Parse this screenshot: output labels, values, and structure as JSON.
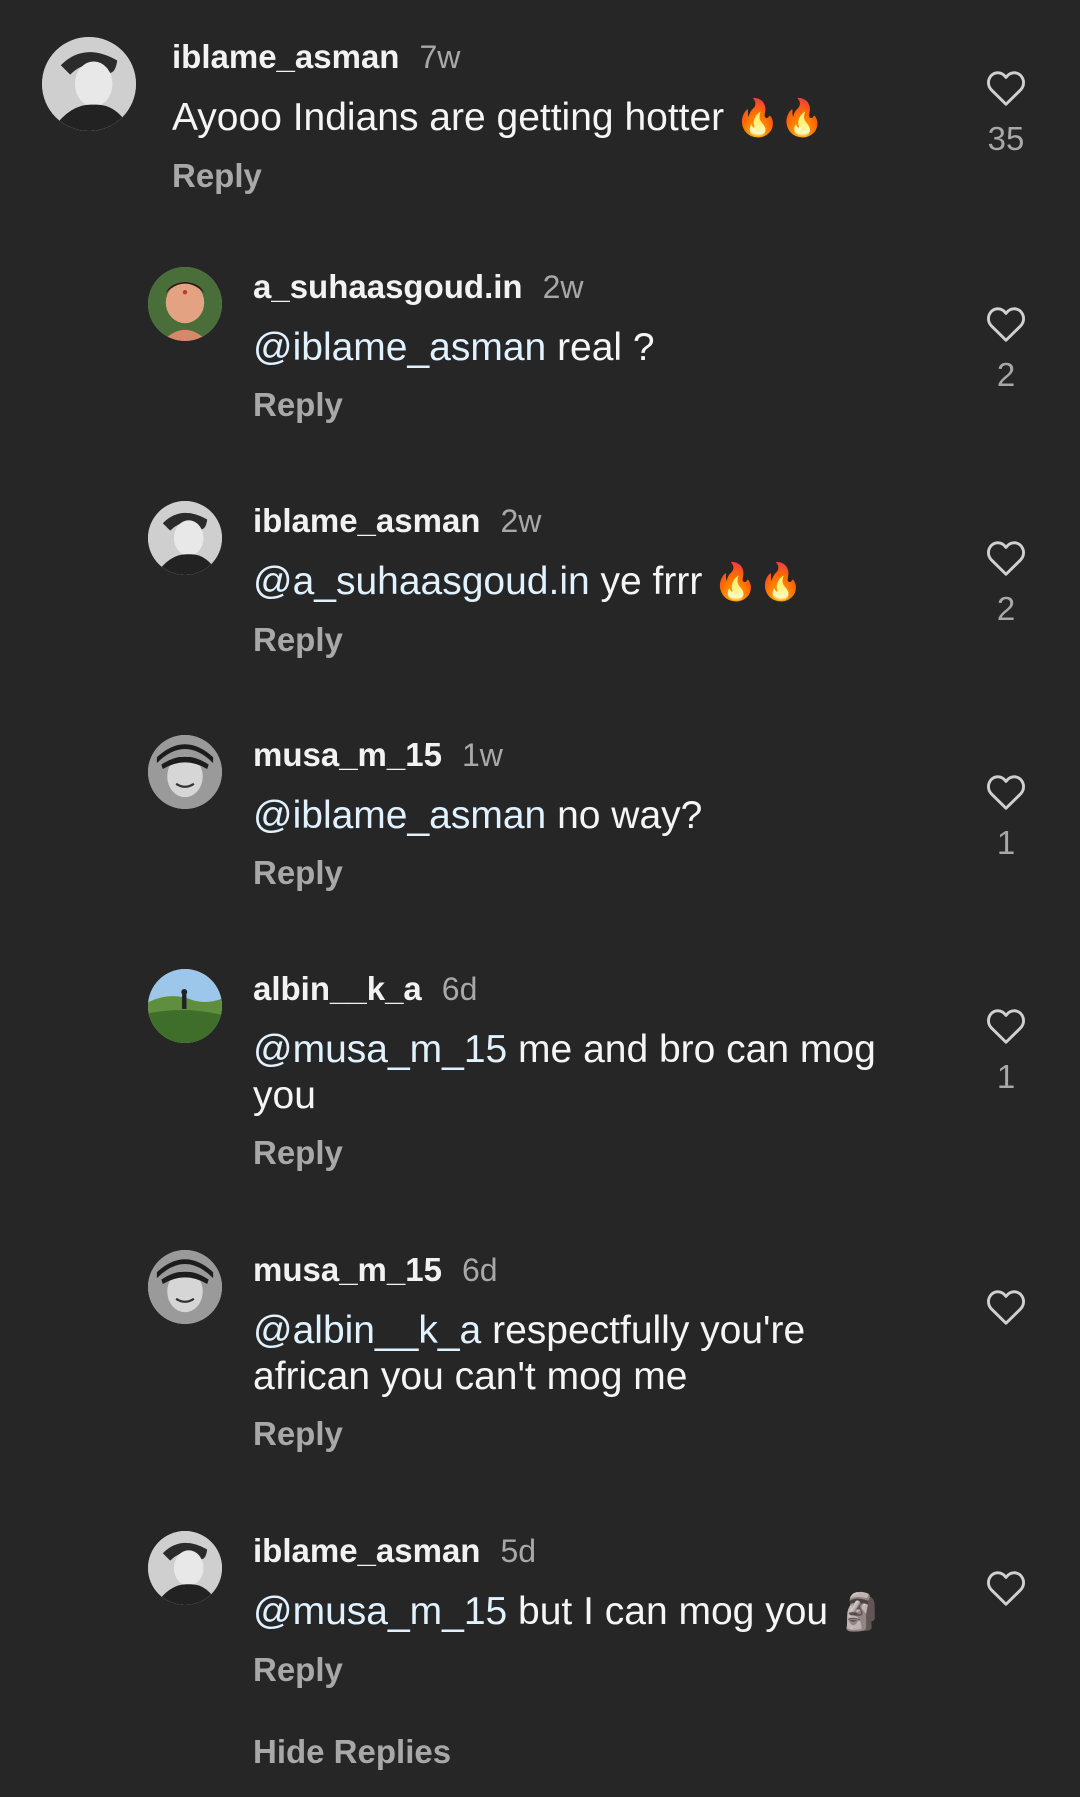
{
  "comments": [
    {
      "username": "iblame_asman",
      "time": "7w",
      "mention": "",
      "text": "Ayooo Indians are getting hotter",
      "emoji": "🔥🔥",
      "reply_label": "Reply",
      "likes": "35",
      "avatar": "avatar-bw-portrait"
    },
    {
      "username": "a_suhaasgoud.in",
      "time": "2w",
      "mention": "@iblame_asman",
      "text": " real ?",
      "emoji": "",
      "reply_label": "Reply",
      "likes": "2",
      "avatar": "avatar-baby-photo"
    },
    {
      "username": "iblame_asman",
      "time": "2w",
      "mention": "@a_suhaasgoud.in",
      "text": " ye frrr",
      "emoji": "🔥🔥",
      "reply_label": "Reply",
      "likes": "2",
      "avatar": "avatar-bw-portrait"
    },
    {
      "username": "musa_m_15",
      "time": "1w",
      "mention": "@iblame_asman",
      "text": " no way?",
      "emoji": "",
      "reply_label": "Reply",
      "likes": "1",
      "avatar": "avatar-bw-face"
    },
    {
      "username": "albin__k_a",
      "time": "6d",
      "mention": "@musa_m_15",
      "text": " me and bro can mog you",
      "emoji": "",
      "reply_label": "Reply",
      "likes": "1",
      "avatar": "avatar-landscape"
    },
    {
      "username": "musa_m_15",
      "time": "6d",
      "mention": "@albin__k_a",
      "text": " respectfully you're african you can't mog me",
      "emoji": "",
      "reply_label": "Reply",
      "likes": "",
      "avatar": "avatar-bw-face"
    },
    {
      "username": "iblame_asman",
      "time": "5d",
      "mention": "@musa_m_15",
      "text": " but I can mog you",
      "emoji": "🗿",
      "reply_label": "Reply",
      "likes": "",
      "avatar": "avatar-bw-portrait"
    }
  ],
  "hide_replies_label": "Hide Replies",
  "icons": {
    "like": "heart-outline-icon"
  },
  "colors": {
    "background": "#262626",
    "text": "#f5f5f5",
    "secondary": "#a8a8a8",
    "mention": "#e0f1ff"
  }
}
